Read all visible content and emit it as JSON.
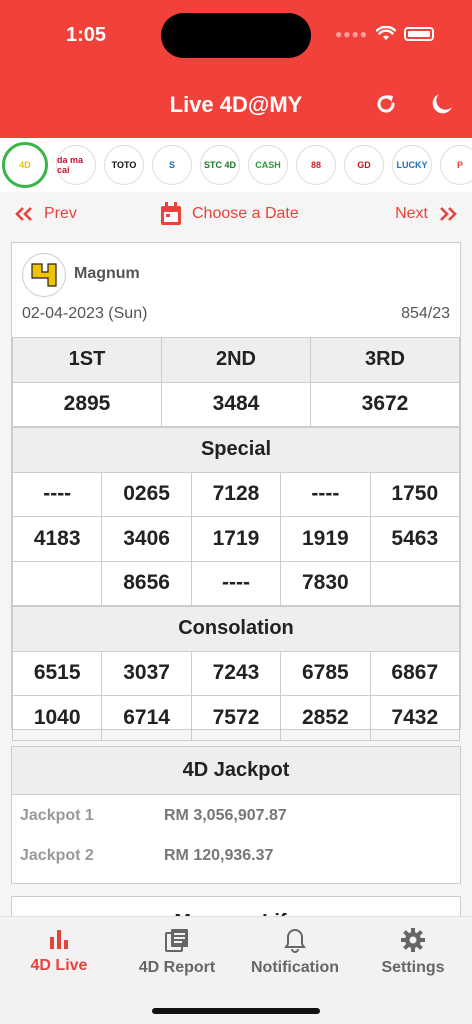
{
  "status": {
    "time": "1:05"
  },
  "header": {
    "title": "Live 4D@MY"
  },
  "operators": [
    {
      "name": "Magnum",
      "short": "4D",
      "color": "#f0c400",
      "active": true
    },
    {
      "name": "Da Ma Cai",
      "short": "da ma cai",
      "color": "#c8102e",
      "active": false
    },
    {
      "name": "Sports Toto",
      "short": "TOTO",
      "color": "#111111",
      "active": false
    },
    {
      "name": "Singapore Pools",
      "short": "S",
      "color": "#1466c2",
      "active": false
    },
    {
      "name": "STC 4D",
      "short": "STC 4D",
      "color": "#1b7a2c",
      "active": false
    },
    {
      "name": "Cash Sweep",
      "short": "CASH",
      "color": "#2c9a3c",
      "active": false
    },
    {
      "name": "Sabah 88",
      "short": "88",
      "color": "#d81e28",
      "active": false
    },
    {
      "name": "GD Lotto",
      "short": "GD",
      "color": "#c7161d",
      "active": false
    },
    {
      "name": "Lucky",
      "short": "LUCKY",
      "color": "#1b6fc2",
      "active": false
    },
    {
      "name": "Perdana",
      "short": "P",
      "color": "#e8433b",
      "active": false
    }
  ],
  "nav": {
    "prev": "Prev",
    "choose_date": "Choose a Date",
    "next": "Next"
  },
  "result": {
    "operator": "Magnum",
    "date": "02-04-2023 (Sun)",
    "draw_no": "854/23",
    "prizes_header": [
      "1ST",
      "2ND",
      "3RD"
    ],
    "prizes": [
      "2895",
      "3484",
      "3672"
    ],
    "special_title": "Special",
    "special": [
      [
        "----",
        "0265",
        "7128",
        "----",
        "1750"
      ],
      [
        "4183",
        "3406",
        "1719",
        "1919",
        "5463"
      ],
      [
        "",
        "8656",
        "----",
        "7830",
        ""
      ]
    ],
    "consolation_title": "Consolation",
    "consolation": [
      [
        "6515",
        "3037",
        "7243",
        "6785",
        "6867"
      ],
      [
        "1040",
        "6714",
        "7572",
        "2852",
        "7432"
      ]
    ]
  },
  "jackpot": {
    "title": "4D Jackpot",
    "rows": [
      {
        "label": "Jackpot 1",
        "value": "RM 3,056,907.87"
      },
      {
        "label": "Jackpot 2",
        "value": "RM 120,936.37"
      }
    ]
  },
  "next_section": {
    "title": "Magnum Life"
  },
  "tabs": [
    {
      "label": "4D Live",
      "icon": "bar-chart-icon",
      "active": true
    },
    {
      "label": "4D Report",
      "icon": "report-icon",
      "active": false
    },
    {
      "label": "Notification",
      "icon": "bell-icon",
      "active": false
    },
    {
      "label": "Settings",
      "icon": "gear-icon",
      "active": false
    }
  ],
  "colors": {
    "brand": "#f2413a",
    "accent": "#e8433b",
    "active_ring": "#3bb54a"
  }
}
